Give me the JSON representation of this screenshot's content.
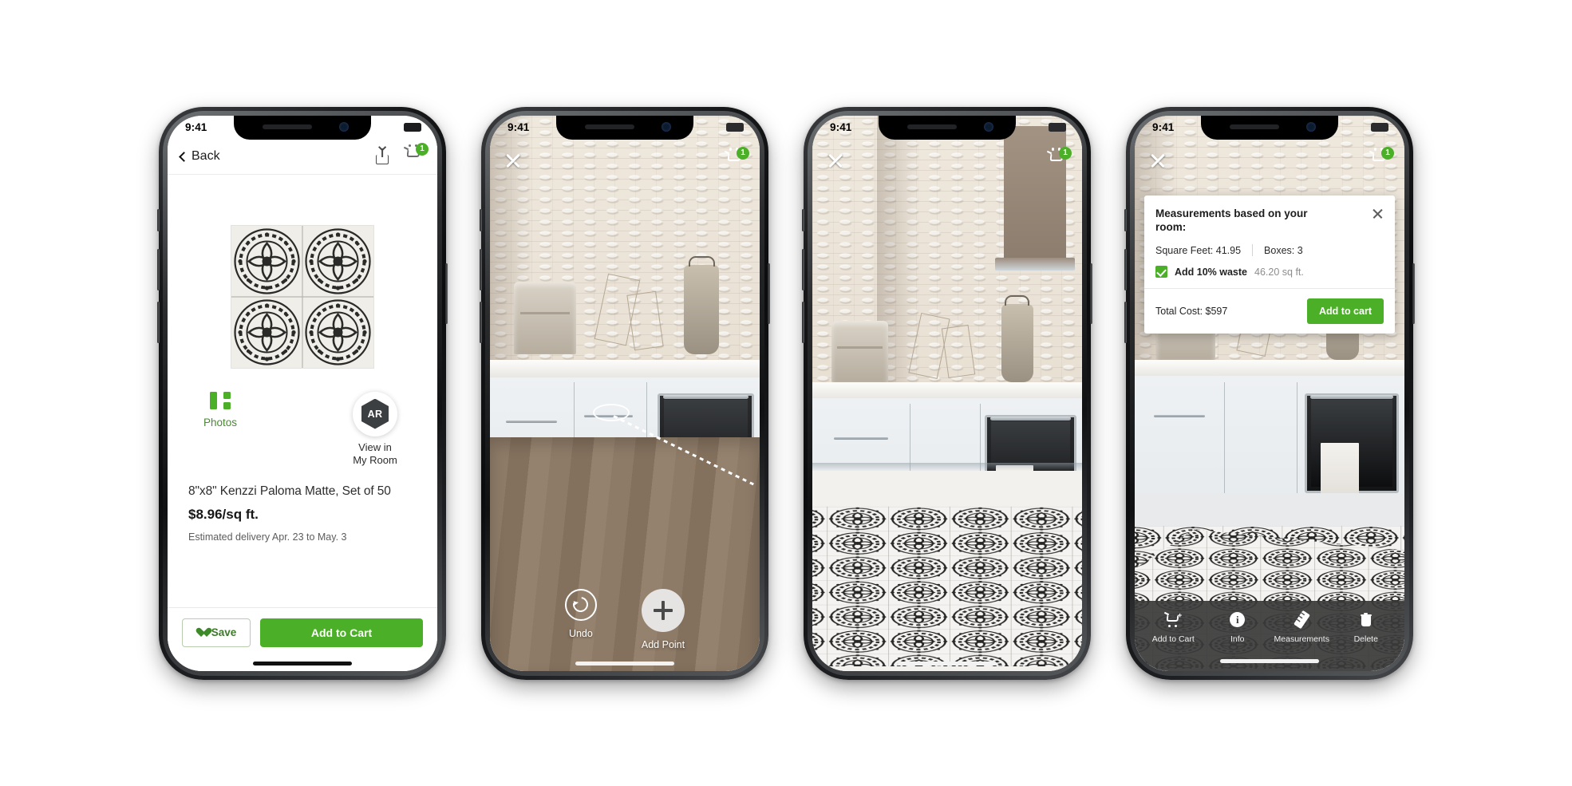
{
  "meta": {
    "status_time": "9:41",
    "accent_green": "#4caf28",
    "cart_badge": "1"
  },
  "phone1": {
    "nav": {
      "back_label": "Back",
      "share_icon": "share-icon",
      "cart_icon": "cart-icon",
      "cart_badge": "1"
    },
    "gallery": {
      "photos_label": "Photos",
      "photos_icon": "photos-grid-icon"
    },
    "ar_entry": {
      "badge_text": "AR",
      "label_line1": "View in",
      "label_line2": "My Room"
    },
    "product": {
      "title": "8\"x8\" Kenzzi Paloma Matte, Set of 50",
      "price": "$8.96/sq ft.",
      "delivery": "Estimated delivery Apr. 23 to May. 3"
    },
    "footer": {
      "save_label": "Save",
      "save_icon": "heart-icon",
      "add_to_cart_label": "Add to Cart"
    }
  },
  "phone2": {
    "nav": {
      "close_icon": "close-icon",
      "cart_icon": "cart-icon",
      "cart_badge": "1"
    },
    "controls": {
      "undo_label": "Undo",
      "undo_icon": "undo-icon",
      "add_point_label": "Add Point",
      "add_point_icon": "plus-icon"
    }
  },
  "phone3": {
    "nav": {
      "close_icon": "close-icon",
      "cart_icon": "cart-icon",
      "cart_badge": "1"
    }
  },
  "phone4": {
    "nav": {
      "close_icon": "close-icon",
      "cart_icon": "cart-icon",
      "cart_badge": "1"
    },
    "popup": {
      "title": "Measurements based on your room:",
      "close_icon": "close-icon",
      "square_feet_label": "Square Feet: 41.95",
      "boxes_label": "Boxes: 3",
      "waste_label": "Add 10% waste",
      "waste_value": "46.20 sq ft.",
      "waste_checked": true,
      "total_label": "Total Cost: $597",
      "cta_label": "Add to cart"
    },
    "toolbar": [
      {
        "label": "Add to Cart",
        "icon": "cart-plus-icon"
      },
      {
        "label": "Info",
        "icon": "info-icon"
      },
      {
        "label": "Measurements",
        "icon": "ruler-icon"
      },
      {
        "label": "Delete",
        "icon": "trash-icon"
      }
    ]
  }
}
